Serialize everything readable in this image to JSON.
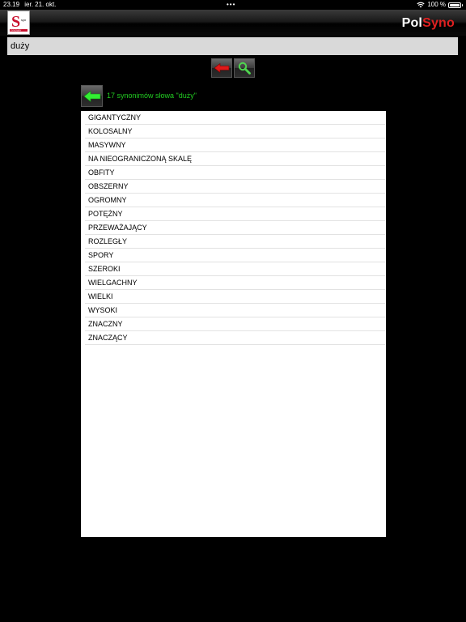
{
  "status_bar": {
    "time": "23.19",
    "date": "ier. 21. okt.",
    "dots": "•••",
    "battery": "100 %",
    "battery_level": 1.0
  },
  "header": {
    "logo_icon": "synonym-s-logo-icon",
    "brand_part1": "Pol",
    "brand_part2": "Syno",
    "brand_color_primary": "#ffffff",
    "brand_color_accent": "#e02020"
  },
  "search": {
    "value": "duży"
  },
  "toolbar": {
    "back_icon": "red-left-arrow-icon",
    "search_icon": "green-magnifier-icon"
  },
  "results": {
    "label": "17 synonimów słowa \"duży\"",
    "label_color": "#22cc22",
    "back_icon": "green-left-arrow-icon",
    "items": [
      "GIGANTYCZNY",
      "KOLOSALNY",
      "MASYWNY",
      "NA NIEOGRANICZONĄ SKALĘ",
      "OBFITY",
      "OBSZERNY",
      "OGROMNY",
      "POTĘŻNY",
      "PRZEWAŻAJĄCY",
      "ROZLEGŁY",
      "SPORY",
      "SZEROKI",
      "WIELGACHNY",
      "WIELKI",
      "WYSOKI",
      "ZNACZNY",
      "ZNACZĄCY"
    ]
  }
}
